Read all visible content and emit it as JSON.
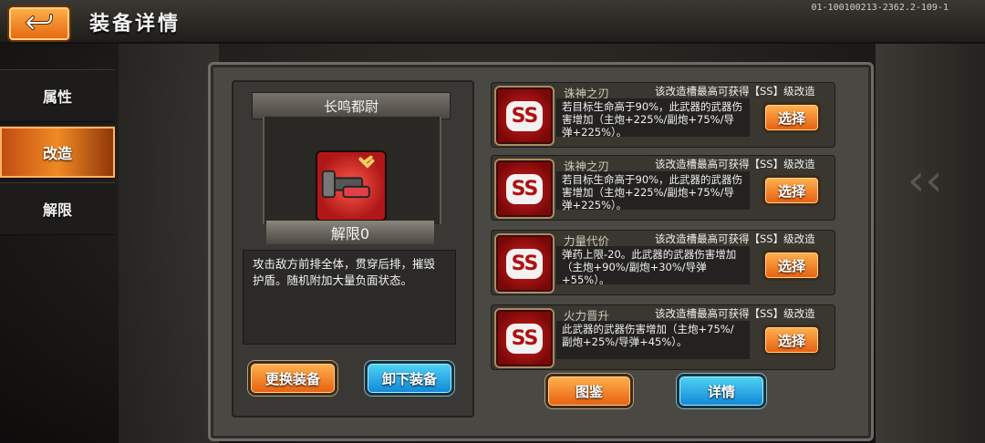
{
  "header": {
    "title": "装备详情",
    "version": "01-100100213-2362.2-109-1",
    "back_icon": "back-arrow-icon"
  },
  "tabs": [
    {
      "label": "属性",
      "active": false
    },
    {
      "label": "改造",
      "active": true
    },
    {
      "label": "解限",
      "active": false
    }
  ],
  "equipment": {
    "name": "长鸣都尉",
    "limit_label": "解限0",
    "description": "攻击敌方前排全体，贯穿后排，摧毁护盾。随机附加大量负面状态。",
    "change_button": "更换装备",
    "unequip_button": "卸下装备"
  },
  "mods": [
    {
      "icon_text": "SS",
      "name": "诛神之刃",
      "header": "该改造槽最高可获得【SS】级改造",
      "desc": "若目标生命高于90%，此武器的武器伤害增加（主炮+225%/副炮+75%/导弹+225%）。",
      "button": "选择"
    },
    {
      "icon_text": "SS",
      "name": "诛神之刃",
      "header": "该改造槽最高可获得【SS】级改造",
      "desc": "若目标生命高于90%，此武器的武器伤害增加（主炮+225%/副炮+75%/导弹+225%）。",
      "button": "选择"
    },
    {
      "icon_text": "SS",
      "name": "力量代价",
      "header": "该改造槽最高可获得【SS】级改造",
      "desc": "弹药上限-20。此武器的武器伤害增加（主炮+90%/副炮+30%/导弹+55%）。",
      "button": "选择"
    },
    {
      "icon_text": "SS",
      "name": "火力晋升",
      "header": "该改造槽最高可获得【SS】级改造",
      "desc": "此武器的武器伤害增加（主炮+75%/副炮+25%/导弹+45%）。",
      "button": "选择"
    }
  ],
  "footer": {
    "catalog_button": "图鉴",
    "details_button": "详情"
  },
  "colors": {
    "accent_orange": "#f08a24",
    "accent_blue": "#1286d8",
    "ss_red": "#b01010"
  }
}
